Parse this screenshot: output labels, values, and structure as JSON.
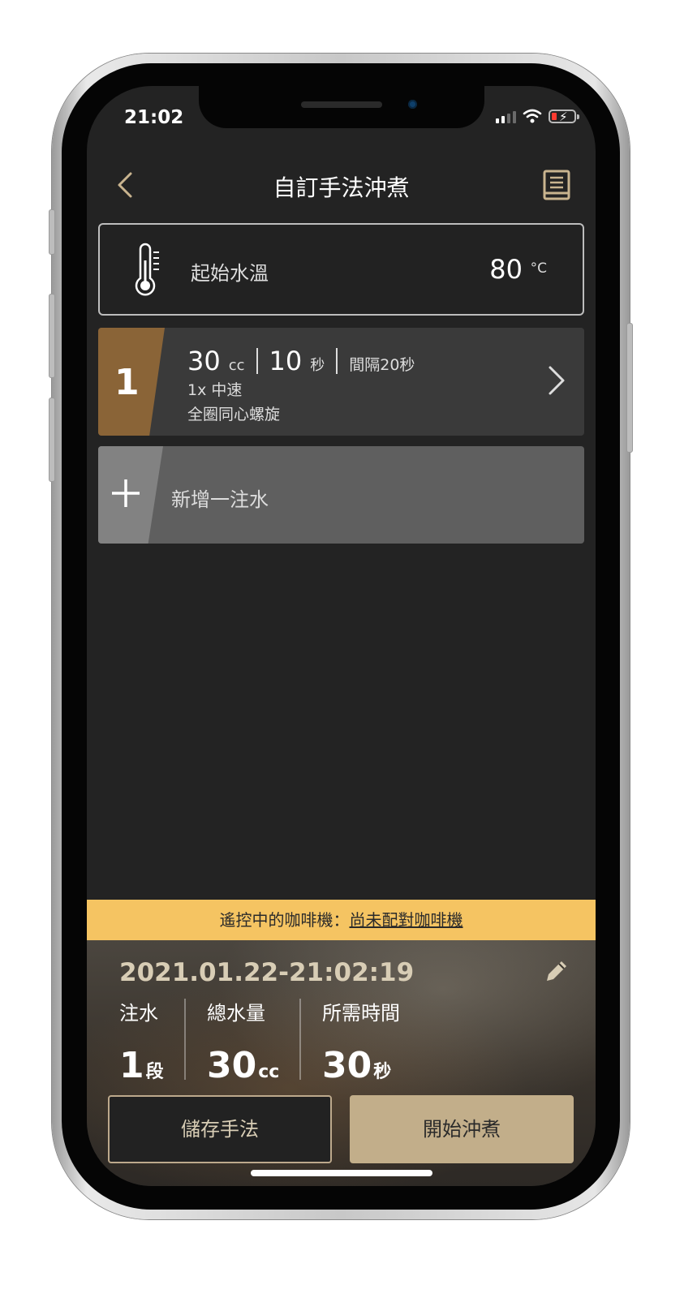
{
  "status_bar": {
    "time": "21:02"
  },
  "header": {
    "title": "自訂手法沖煮"
  },
  "temperature": {
    "label": "起始水溫",
    "value": "80",
    "unit": "°C"
  },
  "steps": [
    {
      "number": "1",
      "water": "30",
      "water_unit": "cc",
      "duration": "10",
      "duration_unit": "秒",
      "interval": "間隔20秒",
      "speed": "1x 中速",
      "pattern": "全圈同心螺旋"
    }
  ],
  "add_step": {
    "label": "新增一注水"
  },
  "banner": {
    "prefix": "遙控中的咖啡機：",
    "link": "尚未配對咖啡機"
  },
  "recipe": {
    "date": "2021.01.22-21:02:19",
    "stats": [
      {
        "label": "注水",
        "value": "1",
        "unit": "段"
      },
      {
        "label": "總水量",
        "value": "30",
        "unit": "cc"
      },
      {
        "label": "所需時間",
        "value": "30",
        "unit": "秒"
      }
    ]
  },
  "actions": {
    "save_label": "儲存手法",
    "start_label": "開始沖煮"
  },
  "colors": {
    "accent": "#8a6437",
    "banner": "#f5c462",
    "start_button": "#c2ae8a"
  }
}
